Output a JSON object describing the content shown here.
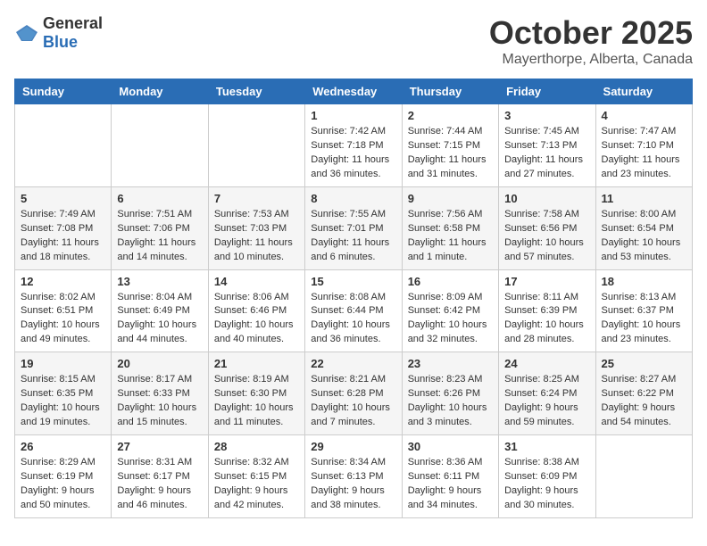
{
  "logo": {
    "general": "General",
    "blue": "Blue"
  },
  "title": "October 2025",
  "location": "Mayerthorpe, Alberta, Canada",
  "days_of_week": [
    "Sunday",
    "Monday",
    "Tuesday",
    "Wednesday",
    "Thursday",
    "Friday",
    "Saturday"
  ],
  "weeks": [
    [
      {
        "day": "",
        "info": ""
      },
      {
        "day": "",
        "info": ""
      },
      {
        "day": "",
        "info": ""
      },
      {
        "day": "1",
        "info": "Sunrise: 7:42 AM\nSunset: 7:18 PM\nDaylight: 11 hours\nand 36 minutes."
      },
      {
        "day": "2",
        "info": "Sunrise: 7:44 AM\nSunset: 7:15 PM\nDaylight: 11 hours\nand 31 minutes."
      },
      {
        "day": "3",
        "info": "Sunrise: 7:45 AM\nSunset: 7:13 PM\nDaylight: 11 hours\nand 27 minutes."
      },
      {
        "day": "4",
        "info": "Sunrise: 7:47 AM\nSunset: 7:10 PM\nDaylight: 11 hours\nand 23 minutes."
      }
    ],
    [
      {
        "day": "5",
        "info": "Sunrise: 7:49 AM\nSunset: 7:08 PM\nDaylight: 11 hours\nand 18 minutes."
      },
      {
        "day": "6",
        "info": "Sunrise: 7:51 AM\nSunset: 7:06 PM\nDaylight: 11 hours\nand 14 minutes."
      },
      {
        "day": "7",
        "info": "Sunrise: 7:53 AM\nSunset: 7:03 PM\nDaylight: 11 hours\nand 10 minutes."
      },
      {
        "day": "8",
        "info": "Sunrise: 7:55 AM\nSunset: 7:01 PM\nDaylight: 11 hours\nand 6 minutes."
      },
      {
        "day": "9",
        "info": "Sunrise: 7:56 AM\nSunset: 6:58 PM\nDaylight: 11 hours\nand 1 minute."
      },
      {
        "day": "10",
        "info": "Sunrise: 7:58 AM\nSunset: 6:56 PM\nDaylight: 10 hours\nand 57 minutes."
      },
      {
        "day": "11",
        "info": "Sunrise: 8:00 AM\nSunset: 6:54 PM\nDaylight: 10 hours\nand 53 minutes."
      }
    ],
    [
      {
        "day": "12",
        "info": "Sunrise: 8:02 AM\nSunset: 6:51 PM\nDaylight: 10 hours\nand 49 minutes."
      },
      {
        "day": "13",
        "info": "Sunrise: 8:04 AM\nSunset: 6:49 PM\nDaylight: 10 hours\nand 44 minutes."
      },
      {
        "day": "14",
        "info": "Sunrise: 8:06 AM\nSunset: 6:46 PM\nDaylight: 10 hours\nand 40 minutes."
      },
      {
        "day": "15",
        "info": "Sunrise: 8:08 AM\nSunset: 6:44 PM\nDaylight: 10 hours\nand 36 minutes."
      },
      {
        "day": "16",
        "info": "Sunrise: 8:09 AM\nSunset: 6:42 PM\nDaylight: 10 hours\nand 32 minutes."
      },
      {
        "day": "17",
        "info": "Sunrise: 8:11 AM\nSunset: 6:39 PM\nDaylight: 10 hours\nand 28 minutes."
      },
      {
        "day": "18",
        "info": "Sunrise: 8:13 AM\nSunset: 6:37 PM\nDaylight: 10 hours\nand 23 minutes."
      }
    ],
    [
      {
        "day": "19",
        "info": "Sunrise: 8:15 AM\nSunset: 6:35 PM\nDaylight: 10 hours\nand 19 minutes."
      },
      {
        "day": "20",
        "info": "Sunrise: 8:17 AM\nSunset: 6:33 PM\nDaylight: 10 hours\nand 15 minutes."
      },
      {
        "day": "21",
        "info": "Sunrise: 8:19 AM\nSunset: 6:30 PM\nDaylight: 10 hours\nand 11 minutes."
      },
      {
        "day": "22",
        "info": "Sunrise: 8:21 AM\nSunset: 6:28 PM\nDaylight: 10 hours\nand 7 minutes."
      },
      {
        "day": "23",
        "info": "Sunrise: 8:23 AM\nSunset: 6:26 PM\nDaylight: 10 hours\nand 3 minutes."
      },
      {
        "day": "24",
        "info": "Sunrise: 8:25 AM\nSunset: 6:24 PM\nDaylight: 9 hours\nand 59 minutes."
      },
      {
        "day": "25",
        "info": "Sunrise: 8:27 AM\nSunset: 6:22 PM\nDaylight: 9 hours\nand 54 minutes."
      }
    ],
    [
      {
        "day": "26",
        "info": "Sunrise: 8:29 AM\nSunset: 6:19 PM\nDaylight: 9 hours\nand 50 minutes."
      },
      {
        "day": "27",
        "info": "Sunrise: 8:31 AM\nSunset: 6:17 PM\nDaylight: 9 hours\nand 46 minutes."
      },
      {
        "day": "28",
        "info": "Sunrise: 8:32 AM\nSunset: 6:15 PM\nDaylight: 9 hours\nand 42 minutes."
      },
      {
        "day": "29",
        "info": "Sunrise: 8:34 AM\nSunset: 6:13 PM\nDaylight: 9 hours\nand 38 minutes."
      },
      {
        "day": "30",
        "info": "Sunrise: 8:36 AM\nSunset: 6:11 PM\nDaylight: 9 hours\nand 34 minutes."
      },
      {
        "day": "31",
        "info": "Sunrise: 8:38 AM\nSunset: 6:09 PM\nDaylight: 9 hours\nand 30 minutes."
      },
      {
        "day": "",
        "info": ""
      }
    ]
  ]
}
